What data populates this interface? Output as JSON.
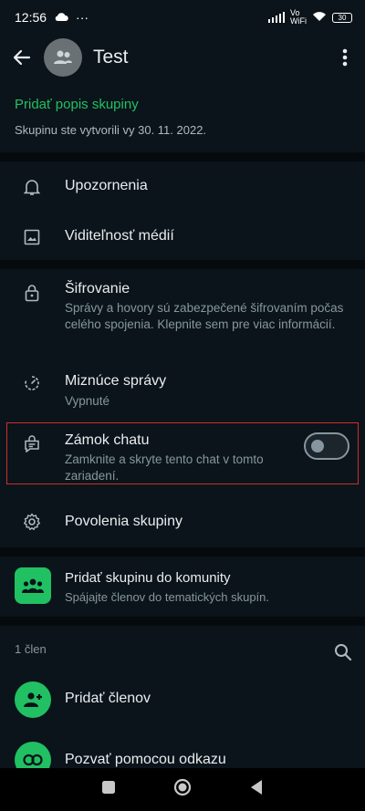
{
  "status_bar": {
    "time": "12:56",
    "more": "···",
    "network": "Vo\nWiFi",
    "battery": "30"
  },
  "app_bar": {
    "title": "Test"
  },
  "description": {
    "add_label": "Pridať popis skupiny",
    "created": "Skupinu ste vytvorili vy 30. 11. 2022."
  },
  "settings": {
    "notifications": "Upozornenia",
    "media_visibility": "Viditeľnosť médií",
    "encryption": {
      "title": "Šifrovanie",
      "subtitle": "Správy a hovory sú zabezpečené šifrovaním počas celého spojenia. Klepnite sem pre viac informácií."
    },
    "disappearing": {
      "title": "Miznúce správy",
      "subtitle": "Vypnuté"
    },
    "chat_lock": {
      "title": "Zámok chatu",
      "subtitle": "Zamknite a skryte tento chat v tomto zariadení.",
      "enabled": false
    },
    "group_permissions": "Povolenia skupiny"
  },
  "community": {
    "title": "Pridať skupinu do komunity",
    "subtitle": "Spájajte členov do tematických skupín."
  },
  "members": {
    "count_label": "1 člen",
    "add_members": "Pridať členov",
    "invite_link": "Pozvať pomocou odkazu"
  },
  "colors": {
    "accent": "#21c063",
    "background": "#0b141a",
    "highlight_border": "#c9302c"
  }
}
